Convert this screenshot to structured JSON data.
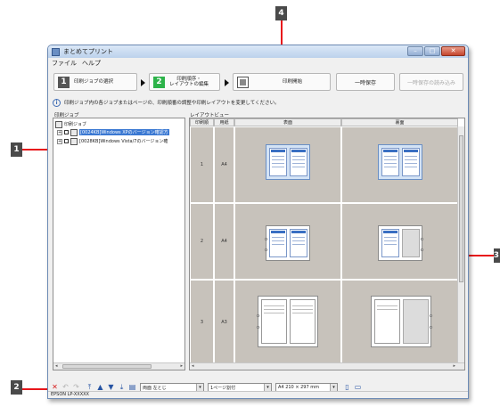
{
  "callouts": {
    "c1": "1",
    "c2": "2",
    "c3": "3",
    "c4": "4"
  },
  "window": {
    "title": "まとめてプリント",
    "controls": {
      "minimize": "–",
      "maximize": "□",
      "close": "✕"
    }
  },
  "menu": [
    "ファイル",
    "ヘルプ"
  ],
  "steps": [
    {
      "number": "1",
      "label": "印刷ジョブの選択"
    },
    {
      "number": "2",
      "label_line1": "印刷順序・",
      "label_line2": "レイアウトの編集"
    },
    {
      "label": "印刷開始"
    }
  ],
  "buttons": {
    "temp_save": "一時保存",
    "load_temp": "一時保存の読み込み"
  },
  "info": {
    "icon": "i",
    "text": "印刷ジョブ内の各ジョブまたはページの、印刷順番の調整や印刷レイアウトを変更してください。"
  },
  "left_pane": {
    "title": "印刷ジョブ",
    "root": "印刷ジョブ",
    "jobs": [
      {
        "expander": "+",
        "text": "[0024KB]Windows XPのバージョン確認方"
      },
      {
        "expander": "+",
        "text": "[0028KB]Windows Vista/7のバージョン確"
      }
    ]
  },
  "right_pane": {
    "title": "レイアウトビュー",
    "columns": [
      "印刷順",
      "用紙",
      "表面",
      "裏面"
    ],
    "rows": [
      {
        "order": "1",
        "paper": "A4"
      },
      {
        "order": "2",
        "paper": "A4"
      },
      {
        "order": "3",
        "paper": "A3"
      }
    ]
  },
  "toolbar": {
    "delete_icon": "✕",
    "undo_icon": "↶",
    "redo_icon": "↷",
    "move_top_icon": "⤒",
    "move_up_icon": "▲",
    "move_down_icon": "▼",
    "move_bottom_icon": "⤓",
    "print_side": "両面 左とじ",
    "pages_per_sheet": "1ページ割付",
    "paper_size": "A4 210 × 297 mm",
    "single_view_icon": "▯",
    "double_view_icon": "▭"
  },
  "status": "EPSON LP-XXXXX"
}
